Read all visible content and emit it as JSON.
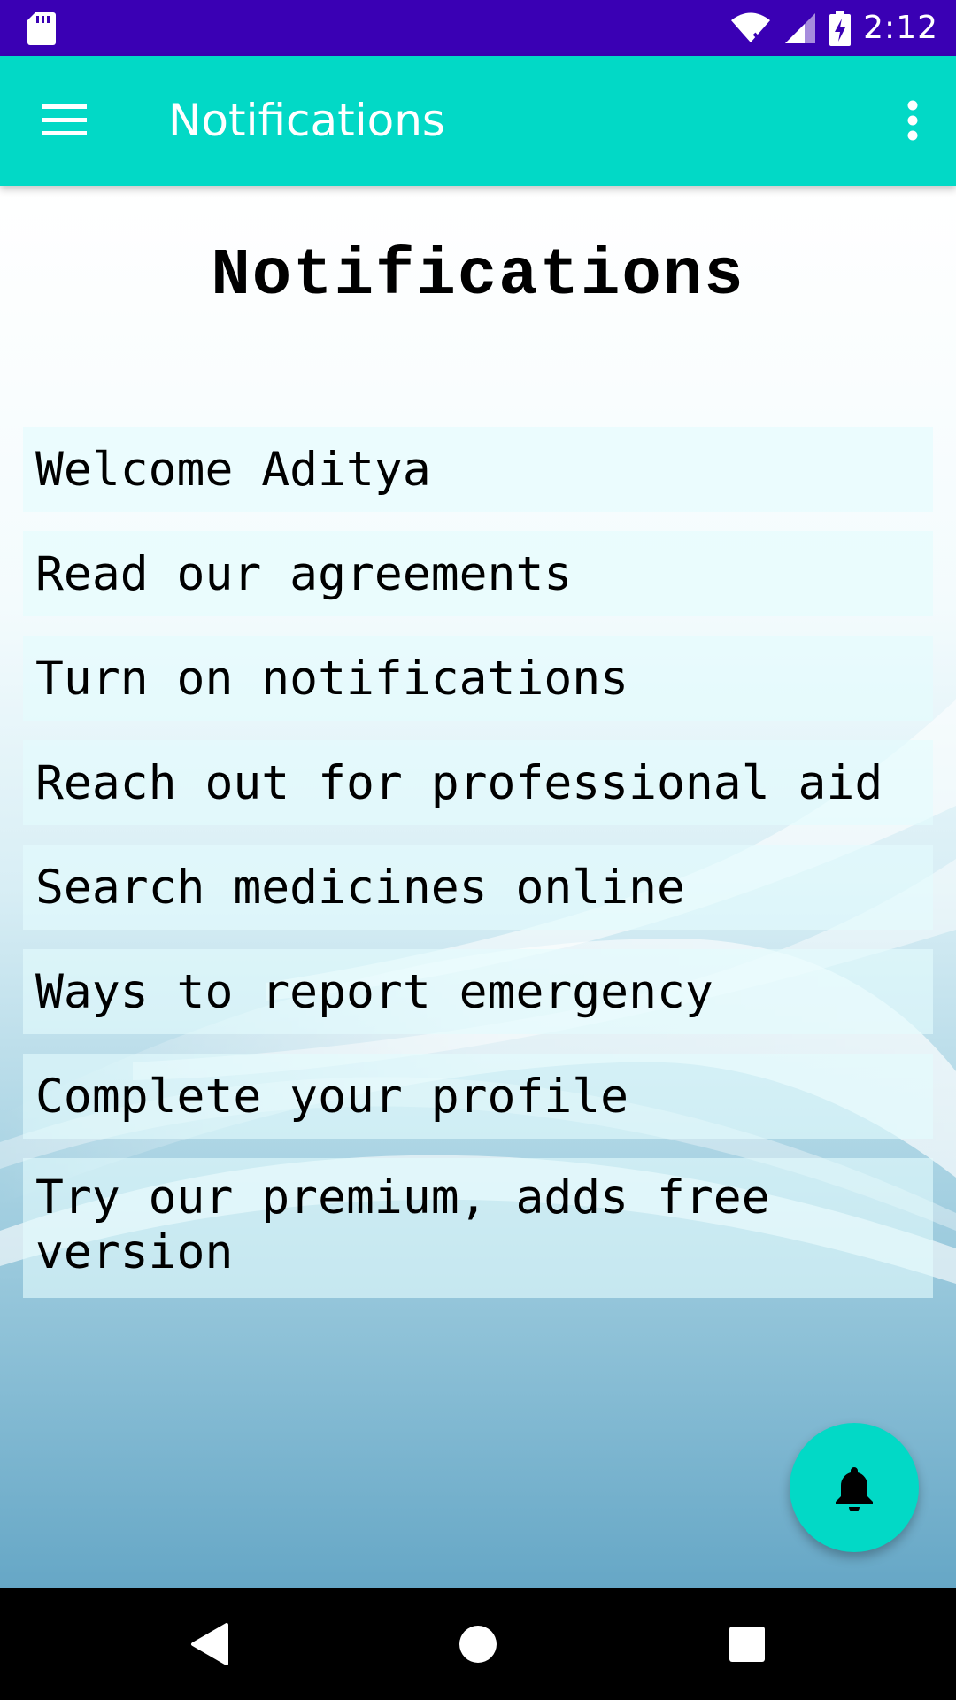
{
  "status_bar": {
    "time": "2:12",
    "icons": [
      "sd-card-icon",
      "wifi-icon",
      "signal-icon",
      "battery-charging-icon"
    ],
    "color": "#3a00b4"
  },
  "app_bar": {
    "title": "Notifications",
    "color": "#02d9c6",
    "icons": [
      "menu-icon",
      "more-vert-icon"
    ]
  },
  "page": {
    "heading": "Notifications"
  },
  "notifications": [
    "Welcome Aditya",
    "Read our agreements",
    "Turn on notifications",
    "Reach out for professional aid",
    "Search medicines online",
    "Ways to report emergency",
    "Complete your profile",
    "Try our premium, adds free version"
  ],
  "fab": {
    "icon": "bell-icon",
    "color": "#02d9c6"
  },
  "nav_bar": {
    "icons": [
      "back-icon",
      "home-icon",
      "recents-icon"
    ]
  }
}
